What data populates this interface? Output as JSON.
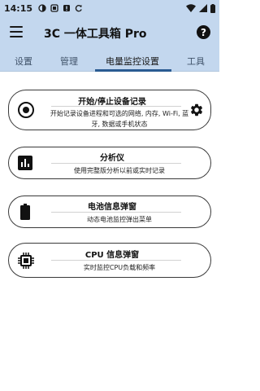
{
  "status_bar": {
    "time": "14:15"
  },
  "app_bar": {
    "title": "3C 一体工具箱 Pro"
  },
  "tabs": [
    {
      "label": "设置",
      "active": false
    },
    {
      "label": "管理",
      "active": false
    },
    {
      "label": "电量监控设置",
      "active": true
    },
    {
      "label": "工具",
      "active": false
    }
  ],
  "cards": [
    {
      "title": "开始/停止设备记录",
      "description": "开始记录设备进程和可选的网络, 内存, Wi-Fi, 蓝牙, 数据或手机状态",
      "icon": "record-icon",
      "has_settings": true
    },
    {
      "title": "分析仪",
      "description": "使用完整版分析以前或实时记录",
      "icon": "bar-chart-icon",
      "has_settings": false
    },
    {
      "title": "电池信息弹窗",
      "description": "动态电池监控弹出菜单",
      "icon": "battery-icon",
      "has_settings": false
    },
    {
      "title": "CPU 信息弹窗",
      "description": "实时监控CPU负载和频率",
      "icon": "cpu-chip-icon",
      "has_settings": false
    }
  ],
  "colors": {
    "header_bg": "#c3d7ee",
    "accent": "#2a5b92",
    "card_border": "#3a3a3a"
  }
}
